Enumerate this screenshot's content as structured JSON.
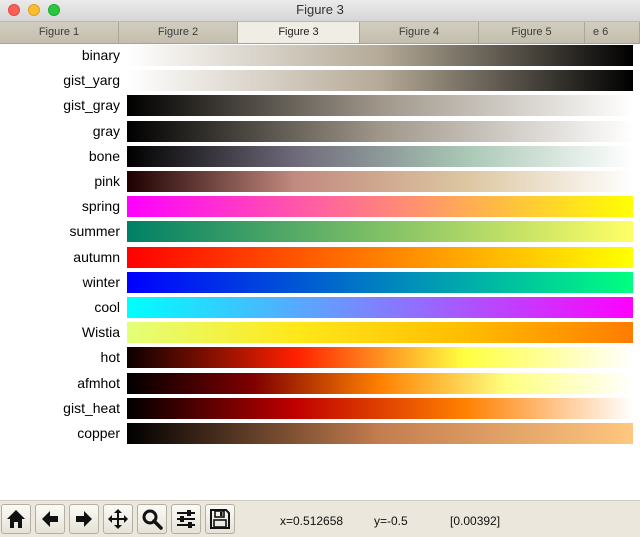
{
  "window": {
    "title": "Figure 3"
  },
  "tabs": [
    {
      "label": "Figure 1",
      "active": false
    },
    {
      "label": "Figure 2",
      "active": false
    },
    {
      "label": "Figure 3",
      "active": true
    },
    {
      "label": "Figure 4",
      "active": false
    },
    {
      "label": "Figure 5",
      "active": false
    },
    {
      "label": "e 6",
      "active": false
    }
  ],
  "colormaps": [
    {
      "name": "binary",
      "stops": [
        "#ffffff",
        "#b5aa97",
        "#000000"
      ]
    },
    {
      "name": "gist_yarg",
      "stops": [
        "#ffffff",
        "#b5aa97",
        "#000000"
      ]
    },
    {
      "name": "gist_gray",
      "stops": [
        "#000000",
        "#a0978a",
        "#ffffff"
      ]
    },
    {
      "name": "gray",
      "stops": [
        "#000000",
        "#a0978a",
        "#ffffff"
      ]
    },
    {
      "name": "bone",
      "stops": [
        "#000000",
        "#6f6a7a",
        "#a9c7b5",
        "#ffffff"
      ]
    },
    {
      "name": "pink",
      "stops": [
        "#1e0000",
        "#c28a80",
        "#dcc6a0",
        "#ffffff"
      ]
    },
    {
      "name": "spring",
      "stops": [
        "#ff00ff",
        "#ff8080",
        "#ffff00"
      ]
    },
    {
      "name": "summer",
      "stops": [
        "#008066",
        "#80c066",
        "#ffff66"
      ]
    },
    {
      "name": "autumn",
      "stops": [
        "#ff0000",
        "#ff8000",
        "#ffff00"
      ]
    },
    {
      "name": "winter",
      "stops": [
        "#0000ff",
        "#0080c0",
        "#00ff80"
      ]
    },
    {
      "name": "cool",
      "stops": [
        "#00ffff",
        "#8080ff",
        "#ff00ff"
      ]
    },
    {
      "name": "Wistia",
      "stops": [
        "#e4ff7a",
        "#ffe81a",
        "#ffbd00",
        "#ff7c00"
      ]
    },
    {
      "name": "hot",
      "stops": [
        "#0b0000",
        "#ff2000",
        "#ffff40",
        "#ffffff"
      ]
    },
    {
      "name": "afmhot",
      "stops": [
        "#000000",
        "#800000",
        "#ff8000",
        "#ffff80",
        "#ffffff"
      ]
    },
    {
      "name": "gist_heat",
      "stops": [
        "#000000",
        "#c00000",
        "#ff8000",
        "#ffffff"
      ]
    },
    {
      "name": "copper",
      "stops": [
        "#000000",
        "#c47d4f",
        "#ffc77f"
      ]
    }
  ],
  "toolbar": {
    "buttons": [
      {
        "name": "home-button",
        "icon": "home-icon"
      },
      {
        "name": "back-button",
        "icon": "arrow-left-icon"
      },
      {
        "name": "forward-button",
        "icon": "arrow-right-icon"
      },
      {
        "name": "pan-button",
        "icon": "move-icon"
      },
      {
        "name": "zoom-button",
        "icon": "magnifier-icon"
      },
      {
        "name": "subplots-button",
        "icon": "sliders-icon"
      },
      {
        "name": "save-button",
        "icon": "floppy-icon"
      }
    ],
    "coords": {
      "x": "x=0.512658",
      "y": "y=-0.5",
      "value": "[0.00392]"
    }
  }
}
